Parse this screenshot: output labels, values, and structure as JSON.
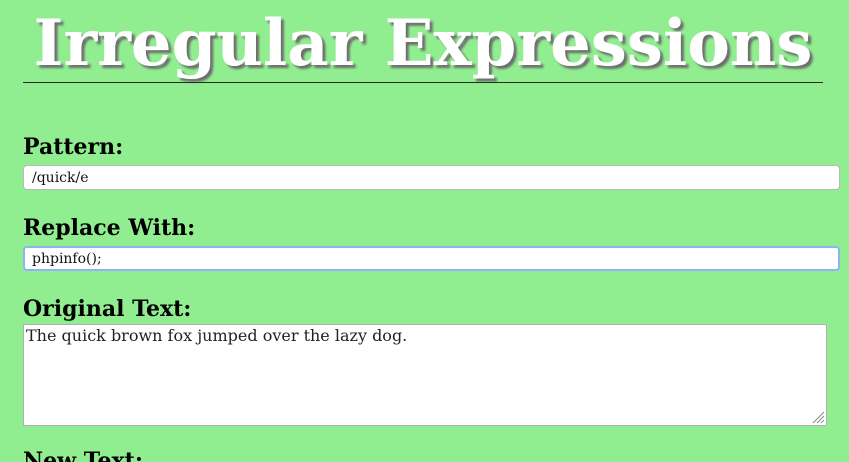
{
  "header": {
    "title": "Irregular Expressions"
  },
  "form": {
    "pattern_label": "Pattern:",
    "pattern_value": "/quick/e",
    "replace_label": "Replace With:",
    "replace_value": "phpinfo();",
    "original_label": "Original Text:",
    "original_value": "The quick brown fox jumped over the lazy dog.",
    "new_label": "New Text:"
  },
  "colors": {
    "background": "#90ee90",
    "title_text": "#ffffff",
    "focus_ring": "#8fb4f6"
  }
}
